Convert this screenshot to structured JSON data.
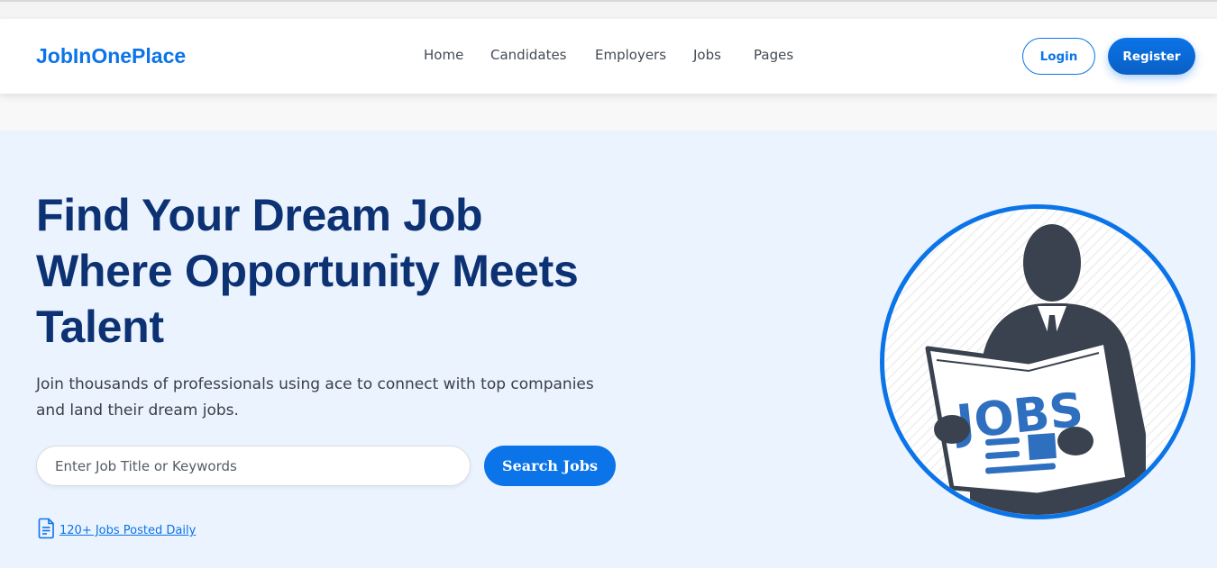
{
  "brand": {
    "name": "JobInOnePlace"
  },
  "nav": {
    "items": [
      {
        "label": "Home"
      },
      {
        "label": "Candidates"
      },
      {
        "label": "Employers"
      },
      {
        "label": "Jobs"
      },
      {
        "label": "Pages"
      }
    ]
  },
  "auth": {
    "login_label": "Login",
    "register_label": "Register"
  },
  "hero": {
    "title_lines": [
      "Find Your Dream Job",
      "Where Opportunity Meets",
      "Talent"
    ],
    "subtitle": "Join thousands of professionals using ace to connect with top companies and land their dream jobs.",
    "search_placeholder": "Enter Job Title or Keywords",
    "search_button": "Search Jobs",
    "stat_link": "120+ Jobs Posted Daily",
    "image_text": "JOBS"
  },
  "colors": {
    "brand_blue": "#0b74e8",
    "title_navy": "#0d3273",
    "hero_bg": "#ebf3fe",
    "figure_dark": "#39424e"
  },
  "icons": {
    "stat_icon": "document-icon"
  }
}
